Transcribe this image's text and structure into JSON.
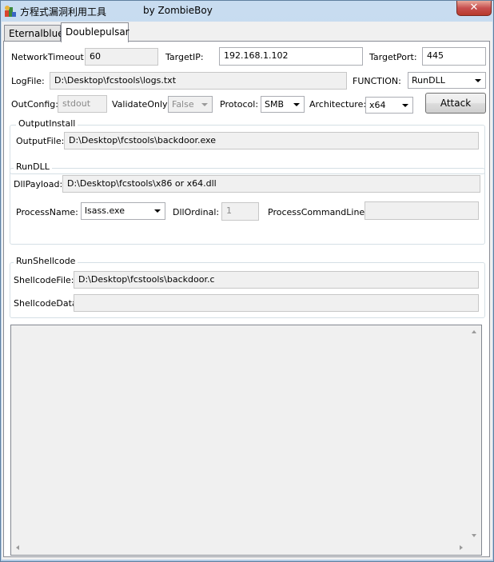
{
  "window": {
    "title": "方程式漏洞利用工具",
    "title_by": "by ZombieBoy",
    "close_label": "✕"
  },
  "tabs": [
    {
      "label": "Eternalblue",
      "active": false
    },
    {
      "label": "Doublepulsar",
      "active": true
    }
  ],
  "form": {
    "network_timeout_label": "NetworkTimeout:",
    "network_timeout_value": "60",
    "target_ip_label": "TargetIP:",
    "target_ip_value": "192.168.1.102",
    "target_port_label": "TargetPort:",
    "target_port_value": "445",
    "logfile_label": "LogFile:",
    "logfile_value": "D:\\Desktop\\fcstools\\logs.txt",
    "function_label": "FUNCTION:",
    "function_value": "RunDLL",
    "outconfig_label": "OutConfig:",
    "outconfig_value": "stdout",
    "validate_label": "ValidateOnly:",
    "validate_value": "False",
    "protocol_label": "Protocol:",
    "protocol_value": "SMB",
    "arch_label": "Architecture:",
    "arch_value": "x64",
    "attack_label": "Attack"
  },
  "output_install": {
    "title": "OutputInstall",
    "outputfile_label": "OutputFile:",
    "outputfile_value": "D:\\Desktop\\fcstools\\backdoor.exe"
  },
  "run_dll": {
    "title": "RunDLL",
    "payload_label": "DllPayload:",
    "payload_value": "D:\\Desktop\\fcstools\\x86 or x64.dll",
    "process_name_label": "ProcessName:",
    "process_name_value": "lsass.exe",
    "ordinal_label": "DllOrdinal:",
    "ordinal_value": "1",
    "cmdline_label": "ProcessCommandLine:",
    "cmdline_value": ""
  },
  "run_shellcode": {
    "title": "RunShellcode",
    "file_label": "ShellcodeFile:",
    "file_value": "D:\\Desktop\\fcstools\\backdoor.c",
    "data_label": "ShellcodeData:",
    "data_value": ""
  },
  "colors": {
    "title_gradient_top": "#c8dcf0",
    "close_red": "#c75050",
    "panel_bg": "#ffffff",
    "client_bg": "#f0f0f0"
  }
}
